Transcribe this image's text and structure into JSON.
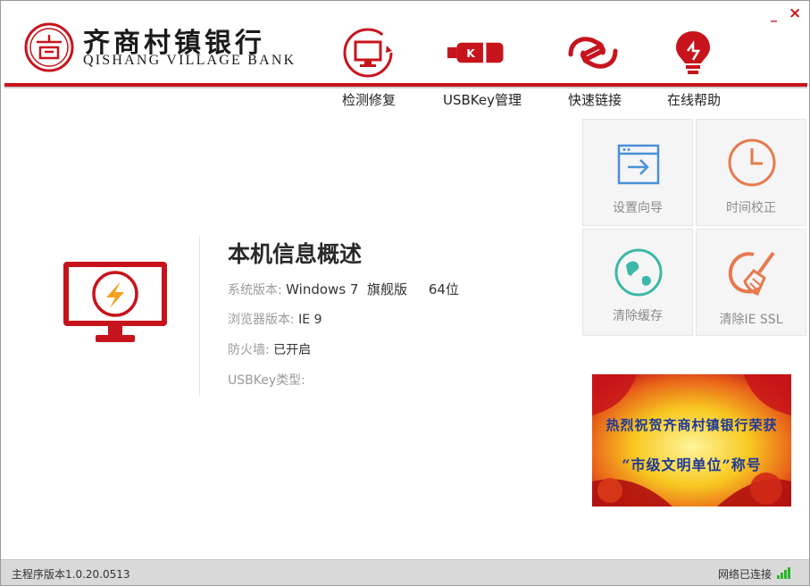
{
  "window": {
    "minimize_label": "_",
    "close_label": "×"
  },
  "header": {
    "bank_name_cn": "齐商村镇银行",
    "bank_name_en": "QISHANG VILLAGE BANK",
    "logo_text": "商"
  },
  "nav": [
    {
      "label": "检测修复",
      "icon": "monitor-refresh-icon"
    },
    {
      "label": "USBKey管理",
      "icon": "usbkey-icon"
    },
    {
      "label": "快速链接",
      "icon": "link-icon"
    },
    {
      "label": "在线帮助",
      "icon": "lightbulb-icon"
    }
  ],
  "tools": [
    {
      "label": "设置向导",
      "icon": "setup-wizard-icon"
    },
    {
      "label": "时间校正",
      "icon": "clock-icon"
    },
    {
      "label": "清除缓存",
      "icon": "globe-icon"
    },
    {
      "label": "清除IE SSL",
      "icon": "broom-icon"
    }
  ],
  "info": {
    "title": "本机信息概述",
    "os_key": "系统版本:",
    "os_value": "Windows 7  旗舰版     64位",
    "browser_key": "浏览器版本:",
    "browser_value": "IE 9",
    "firewall_key": "防火墙:",
    "firewall_value": "已开启",
    "usbkey_key": "USBKey类型:",
    "usbkey_value": ""
  },
  "banner": {
    "line1": "热烈祝贺齐商村镇银行荣获",
    "line2": "“市级文明单位”称号"
  },
  "status": {
    "version": "主程序版本1.0.20.0513",
    "network": "网络已连接"
  },
  "colors": {
    "brand_red": "#c7141c",
    "icon_blue": "#4a90d9",
    "icon_orange": "#e8784d",
    "icon_teal": "#3bb8a8",
    "signal_green": "#2db52d"
  }
}
